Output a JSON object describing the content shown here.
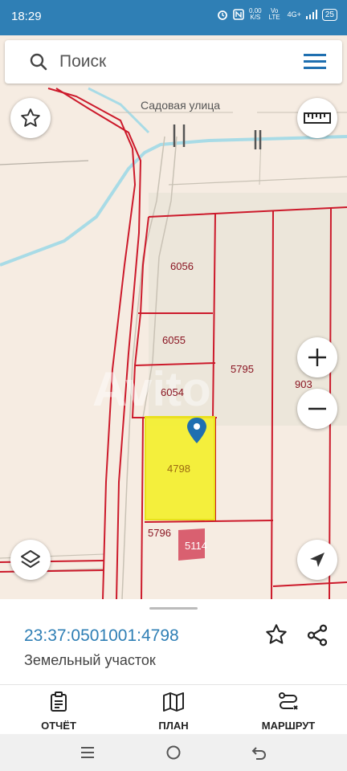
{
  "status_bar": {
    "time": "18:29",
    "net_speed": "0,00",
    "net_unit": "K/S",
    "volte": "Vo LTE",
    "signal": "4G+",
    "battery": "25"
  },
  "search": {
    "placeholder": "Поиск"
  },
  "map": {
    "street_name": "Садовая улица",
    "parcels": [
      "6056",
      "6055",
      "6054",
      "5795",
      "903",
      "4798",
      "5796",
      "5114"
    ],
    "watermark": "Avito",
    "selected_color": "#f4f02a",
    "boundary_color": "#cc1a2b"
  },
  "parcel_sheet": {
    "cadastral_number": "23:37:0501001:4798",
    "type": "Земельный участок"
  },
  "tabs": {
    "report": "ОТЧЁТ",
    "plan": "ПЛАН",
    "route": "МАРШРУТ"
  },
  "colors": {
    "accent": "#2f7fb5"
  }
}
